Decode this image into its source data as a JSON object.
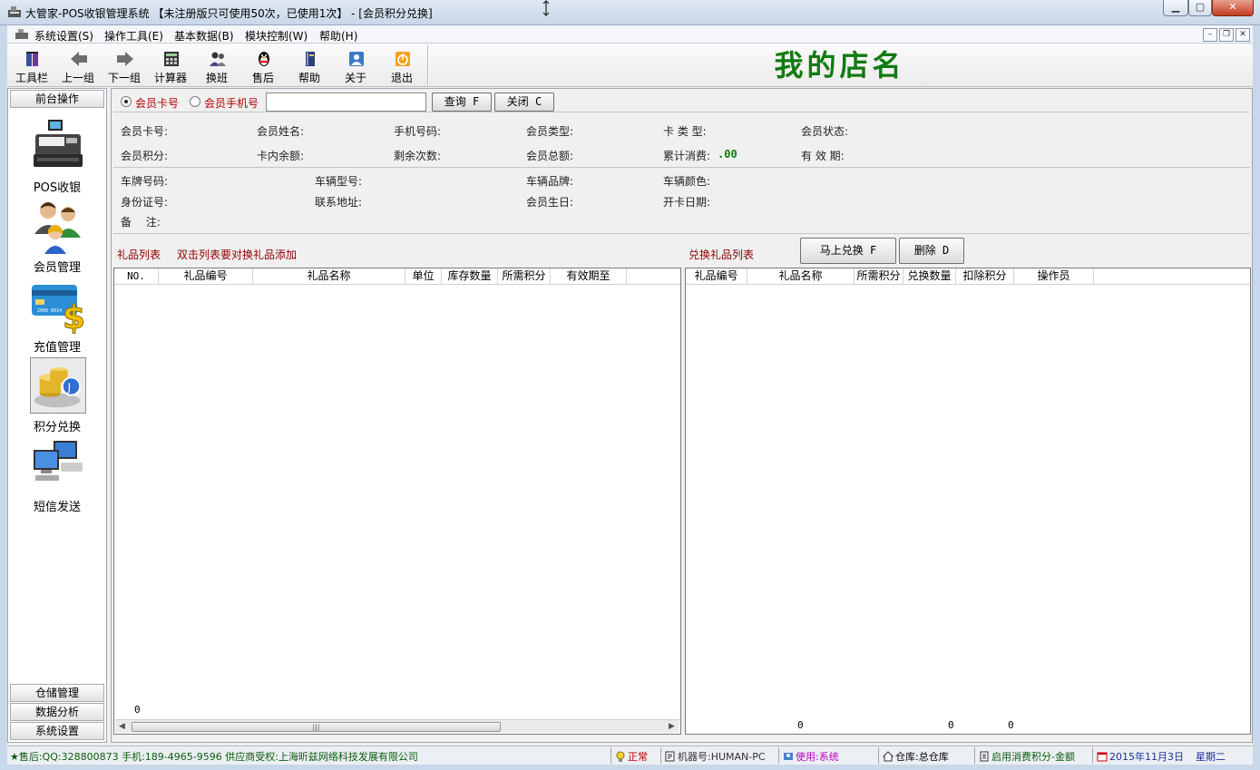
{
  "window": {
    "title": "大管家-POS收银管理系统 【未注册版只可使用50次，已使用1次】 - [会员积分兑换]"
  },
  "menu": {
    "items": [
      "系统设置(S)",
      "操作工具(E)",
      "基本数据(B)",
      "模块控制(W)",
      "帮助(H)"
    ]
  },
  "toolbar": {
    "buttons": [
      {
        "label": "工具栏",
        "icon": "toolbar-book-icon"
      },
      {
        "label": "上一组",
        "icon": "arrow-left-icon"
      },
      {
        "label": "下一组",
        "icon": "arrow-right-icon"
      },
      {
        "label": "计算器",
        "icon": "calculator-icon"
      },
      {
        "label": "换班",
        "icon": "users-swap-icon"
      },
      {
        "label": "售后",
        "icon": "penguin-icon"
      },
      {
        "label": "帮助",
        "icon": "help-book-icon"
      },
      {
        "label": "关于",
        "icon": "about-user-icon"
      },
      {
        "label": "退出",
        "icon": "power-icon"
      }
    ],
    "store_name": "我的店名"
  },
  "leftnav": {
    "top_header": "前台操作",
    "items": [
      {
        "label": "POS收银",
        "icon": "pos-register-icon"
      },
      {
        "label": "会员管理",
        "icon": "members-icon"
      },
      {
        "label": "充值管理",
        "icon": "card-dollar-icon"
      },
      {
        "label": "积分兑换",
        "icon": "coins-exchange-icon"
      },
      {
        "label": "短信发送",
        "icon": "computers-network-icon"
      }
    ],
    "bottom_headers": [
      "仓储管理",
      "数据分析",
      "系统设置"
    ]
  },
  "search": {
    "option_card": "会员卡号",
    "option_phone": "会员手机号",
    "input_value": "",
    "query_label": "查询 F",
    "close_label": "关闭 C"
  },
  "member_info": {
    "card_no": "会员卡号:",
    "name": "会员姓名:",
    "phone": "手机号码:",
    "type": "会员类型:",
    "card_type": "卡 类 型:",
    "status": "会员状态:",
    "points": "会员积分:",
    "balance": "卡内余额:",
    "remaining_times": "剩余次数:",
    "total_amount": "会员总额:",
    "cumulative_spend": "累计消费:",
    "cumulative_spend_value": ".00",
    "valid_period": "有 效 期:"
  },
  "vehicle_info": {
    "plate_no": "车牌号码:",
    "model": "车辆型号:",
    "brand": "车辆品牌:",
    "color": "车辆颜色:",
    "id_no": "身份证号:",
    "address": "联系地址:",
    "birthday": "会员生日:",
    "open_date": "开卡日期:",
    "remark": "备　 注:"
  },
  "gift_list": {
    "title": "礼品列表",
    "hint": "双击列表要对换礼品添加",
    "columns": [
      "NO.",
      "礼品编号",
      "礼品名称",
      "单位",
      "库存数量",
      "所需积分",
      "有效期至"
    ],
    "footer_count": "0"
  },
  "exchange_list": {
    "title": "兑换礼品列表",
    "exchange_now_label": "马上兑换 F",
    "delete_label": "删除 D",
    "columns": [
      "礼品编号",
      "礼品名称",
      "所需积分",
      "兑换数量",
      "扣除积分",
      "操作员"
    ],
    "footer_col2": "0",
    "footer_col4": "0",
    "footer_col5": "0"
  },
  "statusbar": {
    "support": "★售后:QQ:328800873 手机:189-4965-9596 供应商受权:上海昕兹网络科技发展有限公司",
    "state": "正常",
    "machine": "机器号:HUMAN-PC",
    "user": "使用:系统",
    "warehouse": "仓库:总仓库",
    "points_mode": "启用消费积分-金额",
    "date": "2015年11月3日",
    "weekday": "星期二"
  },
  "colors": {
    "store_name": "#127a12",
    "accent_red": "#b30000",
    "section_title": "#8b0000"
  }
}
